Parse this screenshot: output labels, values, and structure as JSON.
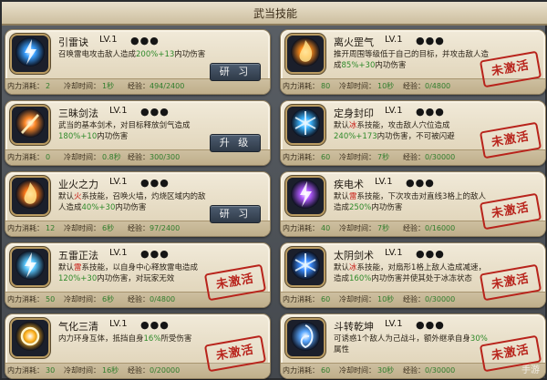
{
  "window": {
    "title": "武当技能"
  },
  "labels": {
    "cost": "内力消耗",
    "cooldown": "冷却时间",
    "exp": "经验",
    "stamp": "未激活"
  },
  "skills_left": [
    {
      "name": "引雷诀",
      "level": "LV.1",
      "dots": "●●●",
      "desc_parts": [
        "召唤雷电攻击敌人造成",
        "200%+13",
        "内功伤害"
      ],
      "desc_colors": [
        "",
        "hl-green",
        ""
      ],
      "cost": "2",
      "cooldown": "1秒",
      "exp": "494/2400",
      "action": "研 习",
      "icon": "lightning-orb-icon",
      "icon_color": "#3aa0ff"
    },
    {
      "name": "三昧剑法",
      "level": "LV.1",
      "dots": "●●●",
      "desc_parts": [
        "武当的基本剑术，对目标释放剑气造成",
        "180%+10",
        "内功伤害"
      ],
      "desc_colors": [
        "",
        "hl-green",
        ""
      ],
      "cost": "0",
      "cooldown": "0.8秒",
      "exp": "300/300",
      "action": "升 级",
      "icon": "sword-flame-icon",
      "icon_color": "#ff8a2a"
    },
    {
      "name": "业火之力",
      "level": "LV.1",
      "dots": "●●●",
      "desc_parts": [
        "默认",
        "火",
        "系技能，召唤火墙，灼烧区域内的敌人造成",
        "40%+30",
        "内功伤害"
      ],
      "desc_colors": [
        "",
        "hl-red",
        "",
        "hl-green",
        ""
      ],
      "cost": "12",
      "cooldown": "6秒",
      "exp": "97/2400",
      "action": "研 习",
      "icon": "fire-wall-icon",
      "icon_color": "#ff7a1a"
    },
    {
      "name": "五雷正法",
      "level": "LV.1",
      "dots": "●●●",
      "desc_parts": [
        "默认",
        "雷",
        "系技能，以自身中心释放雷电造成",
        "120%+30",
        "内功伤害，对玩家无效"
      ],
      "desc_colors": [
        "",
        "hl-red",
        "",
        "hl-green",
        ""
      ],
      "cost": "50",
      "cooldown": "6秒",
      "exp": "0/4800",
      "action": "",
      "icon": "thunder-burst-icon",
      "icon_color": "#5ac8ff"
    },
    {
      "name": "气化三清",
      "level": "LV.1",
      "dots": "●●●",
      "desc_parts": [
        "内力环身互体，抵挡自身",
        "16%",
        "所受伤害"
      ],
      "desc_colors": [
        "",
        "hl-green",
        ""
      ],
      "cost": "30",
      "cooldown": "16秒",
      "exp": "0/20000",
      "action": "",
      "icon": "golden-shield-icon",
      "icon_color": "#ffb21f"
    }
  ],
  "skills_right": [
    {
      "name": "离火罡气",
      "level": "LV.1",
      "dots": "●●●",
      "desc_parts": [
        "推开周围等级低于自己的目标，并攻击敌人造成",
        "85%+30",
        "内功伤害"
      ],
      "desc_colors": [
        "",
        "hl-green",
        ""
      ],
      "cost": "80",
      "cooldown": "10秒",
      "exp": "0/4800",
      "action": "",
      "icon": "fire-ring-icon",
      "icon_color": "#ff8c1a"
    },
    {
      "name": "定身封印",
      "level": "LV.1",
      "dots": "●●●",
      "desc_parts": [
        "默认",
        "冰",
        "系技能，攻击敌人穴位造成",
        "240%+173",
        "内功伤害，不可被闪避"
      ],
      "desc_colors": [
        "",
        "hl-red",
        "",
        "hl-green",
        ""
      ],
      "cost": "60",
      "cooldown": "7秒",
      "exp": "0/30000",
      "action": "",
      "icon": "ice-seal-icon",
      "icon_color": "#3ab4ff"
    },
    {
      "name": "疾电术",
      "level": "LV.1",
      "dots": "●●●",
      "desc_parts": [
        "默认",
        "雷",
        "系技能，下次攻击对直线3格上的敌人造成",
        "250%",
        "内功伤害"
      ],
      "desc_colors": [
        "",
        "hl-red",
        "",
        "hl-green",
        ""
      ],
      "cost": "40",
      "cooldown": "7秒",
      "exp": "0/16000",
      "action": "",
      "icon": "purple-lightning-icon",
      "icon_color": "#b05aff"
    },
    {
      "name": "太阴剑术",
      "level": "LV.1",
      "dots": "●●●",
      "desc_parts": [
        "默认",
        "冰",
        "系技能，对扇形1格上敌人造成减速，造成",
        "160%",
        "内功伤害并使其处于冰冻状态"
      ],
      "desc_colors": [
        "",
        "hl-red",
        "",
        "hl-green",
        ""
      ],
      "cost": "60",
      "cooldown": "10秒",
      "exp": "0/30000",
      "action": "",
      "icon": "ice-blade-icon",
      "icon_color": "#3a8cff"
    },
    {
      "name": "斗转乾坤",
      "level": "LV.1",
      "dots": "●●●",
      "desc_parts": [
        "可诱惑1个敌人为己战斗，额外继承自身",
        "30%",
        "属性"
      ],
      "desc_colors": [
        "",
        "hl-green",
        ""
      ],
      "cost": "60",
      "cooldown": "30秒",
      "exp": "0/30000",
      "action": "",
      "icon": "spirit-swirl-icon",
      "icon_color": "#5aa8ff"
    }
  ],
  "watermark": "手游"
}
